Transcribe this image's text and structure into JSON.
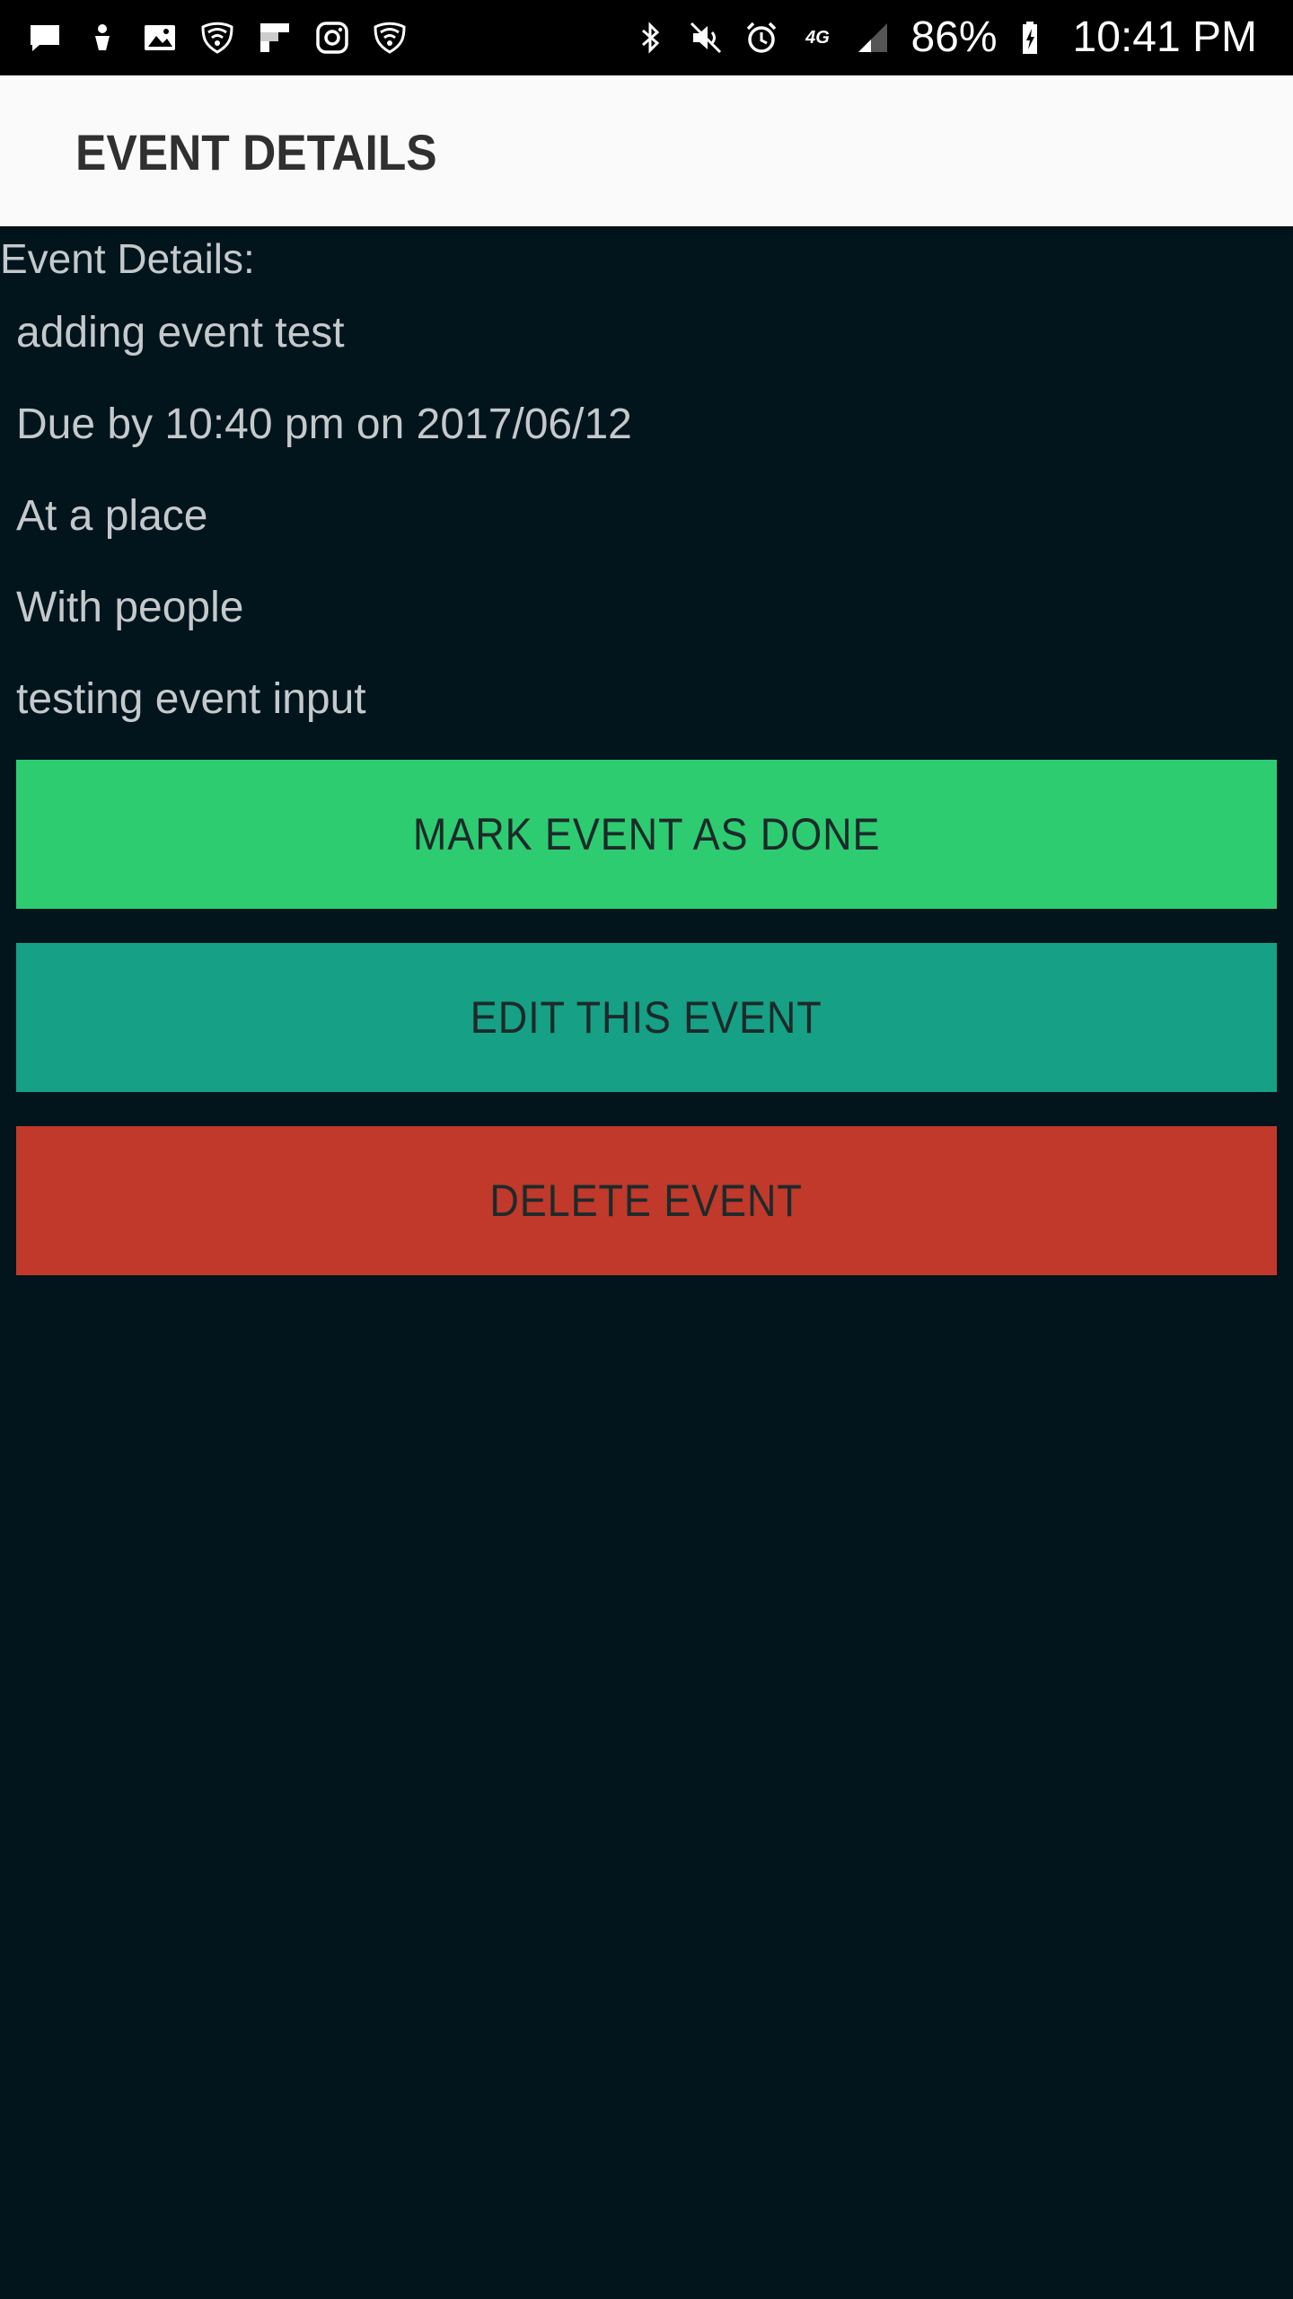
{
  "status_bar": {
    "left_icons": [
      "message-icon",
      "download-icon",
      "image-icon",
      "wifi-shield-icon",
      "flipboard-icon",
      "instagram-icon",
      "wifi-shield-icon"
    ],
    "right_icons": [
      "bluetooth-icon",
      "mute-icon",
      "alarm-icon",
      "network-icon",
      "signal-icon",
      "battery-charging-icon"
    ],
    "network_label": "4G",
    "battery": "86%",
    "time": "10:41 PM"
  },
  "app_bar": {
    "title": "EVENT DETAILS",
    "background": "#fafafa",
    "title_color": "#303030"
  },
  "event": {
    "section_label": "Event Details:",
    "name": "adding event test",
    "due": "Due by 10:40 pm on 2017/06/12",
    "location": "At a place",
    "people": "With people",
    "notes": "testing event input"
  },
  "actions": {
    "done_label": "MARK EVENT AS DONE",
    "edit_label": "EDIT THIS EVENT",
    "delete_label": "DELETE EVENT"
  },
  "colors": {
    "background": "#02141c",
    "done": "#2ecc71",
    "edit": "#16a085",
    "delete": "#c0392b",
    "text": "#c4c9cc"
  }
}
